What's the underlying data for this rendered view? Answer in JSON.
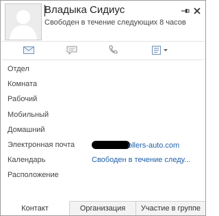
{
  "contact": {
    "name": "Владыка Сидиус",
    "status": "Свободен в течение следующих 8 часов"
  },
  "icons": {
    "avatar": "person-silhouette",
    "pin": "pin-icon",
    "close": "close-icon",
    "mail": "mail-icon",
    "chat": "chat-icon",
    "call": "phone-icon",
    "more": "contact-card-icon"
  },
  "fields": [
    {
      "label": "Отдел",
      "value": ""
    },
    {
      "label": "Комната",
      "value": ""
    },
    {
      "label": "Рабочий",
      "value": ""
    },
    {
      "label": "Мобильный",
      "value": ""
    },
    {
      "label": "Домашний",
      "value": ""
    },
    {
      "label": "Электронная почта",
      "value": "ollers-auto.com"
    },
    {
      "label": "Календарь",
      "value": "Свободен в течение следу..."
    },
    {
      "label": "Расположение",
      "value": ""
    }
  ],
  "tabs": [
    {
      "label": "Контакт",
      "active": true
    },
    {
      "label": "Организация",
      "active": false
    },
    {
      "label": "Участие в группе",
      "active": false
    }
  ],
  "colors": {
    "link": "#1f5fa8",
    "text": "#444444",
    "border": "#9c9c9c"
  }
}
